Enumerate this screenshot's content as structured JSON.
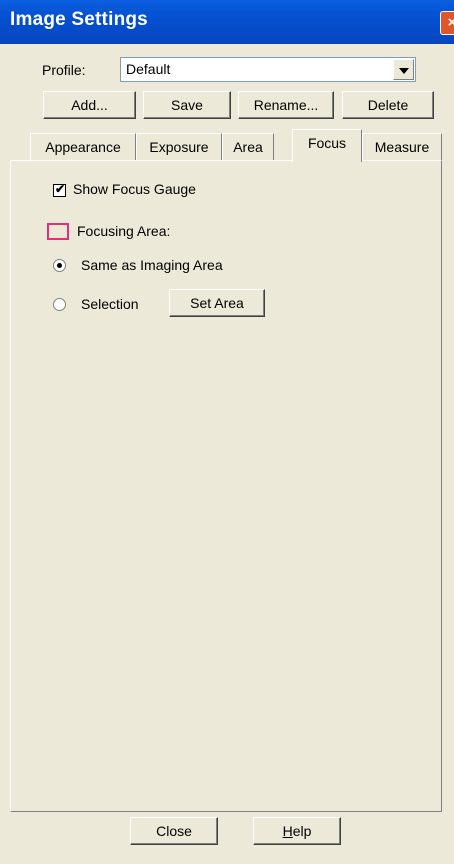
{
  "window": {
    "title": "Image Settings",
    "close_glyph": "×"
  },
  "profile": {
    "label": "Profile:",
    "value": "Default"
  },
  "buttons": {
    "add": "Add...",
    "save": "Save",
    "rename": "Rename...",
    "delete": "Delete"
  },
  "tabs": [
    {
      "label": "Appearance"
    },
    {
      "label": "Exposure"
    },
    {
      "label": "Area"
    },
    {
      "label": "Focus",
      "active": true
    },
    {
      "label": "Measure"
    }
  ],
  "focus": {
    "show_gauge": {
      "label": "Show Focus Gauge",
      "checked": true,
      "mark": "✔"
    },
    "focusing_area_label": "Focusing Area:",
    "radio_same": "Same as Imaging Area",
    "radio_selection": "Selection",
    "selected": "same",
    "set_area": "Set Area"
  },
  "footer": {
    "close": "Close",
    "help": "Help",
    "help_mnemonic": "H",
    "help_rest": "elp"
  },
  "colors": {
    "titlebar": "#0A5FE0",
    "face": "#ECE9D8",
    "focus_area_outline": "#E0307A"
  }
}
